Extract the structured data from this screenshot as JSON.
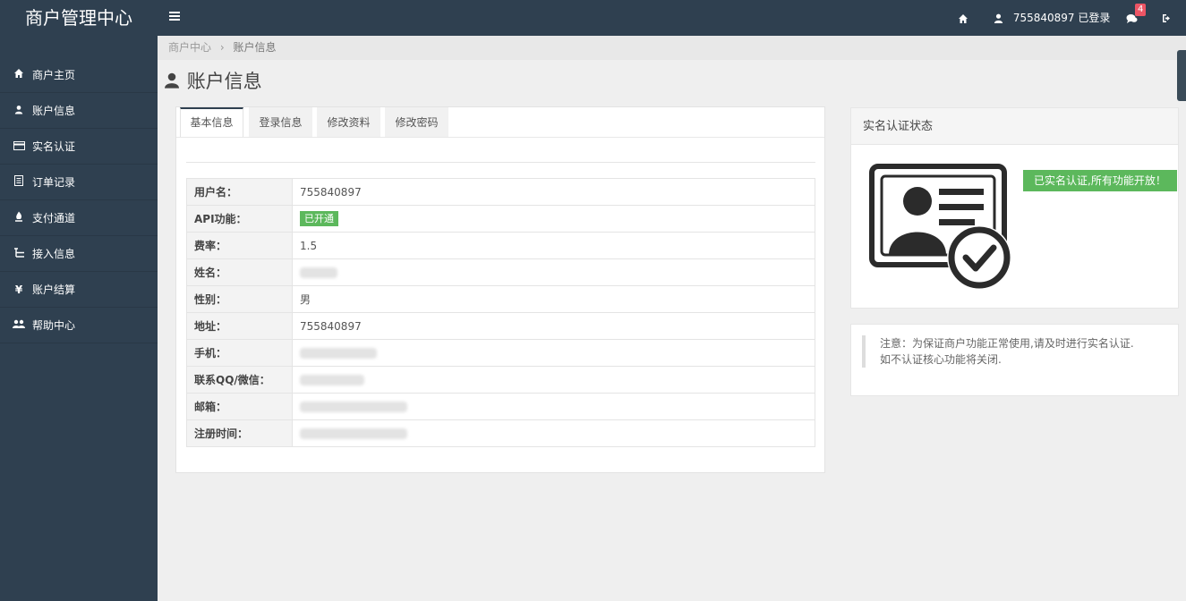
{
  "app": {
    "title": "商户管理中心"
  },
  "topbar": {
    "user_label": "755840897 已登录",
    "message_count": "4"
  },
  "sidebar": {
    "items": [
      {
        "label": "商户主页",
        "icon": "home-icon"
      },
      {
        "label": "账户信息",
        "icon": "user-icon"
      },
      {
        "label": "实名认证",
        "icon": "credit-card-icon"
      },
      {
        "label": "订单记录",
        "icon": "receipt-icon"
      },
      {
        "label": "支付通道",
        "icon": "fire-icon"
      },
      {
        "label": "接入信息",
        "icon": "sitemap-icon"
      },
      {
        "label": "账户结算",
        "icon": "yen-icon"
      },
      {
        "label": "帮助中心",
        "icon": "users-icon"
      }
    ]
  },
  "breadcrumb": {
    "root": "商户中心",
    "sep": "›",
    "current": "账户信息"
  },
  "page": {
    "title": "账户信息"
  },
  "tabs": [
    "基本信息",
    "登录信息",
    "修改资料",
    "修改密码"
  ],
  "info": {
    "rows": [
      {
        "key": "用户名：",
        "value": "755840897"
      },
      {
        "key": "API功能：",
        "value": "已开通"
      },
      {
        "key": "费率：",
        "value": "1.5"
      },
      {
        "key": "姓名：",
        "value": ""
      },
      {
        "key": "性别：",
        "value": "男"
      },
      {
        "key": "地址：",
        "value": "755840897"
      },
      {
        "key": "手机：",
        "value": ""
      },
      {
        "key": "联系QQ/微信：",
        "value": ""
      },
      {
        "key": "邮箱：",
        "value": ""
      },
      {
        "key": "注册时间：",
        "value": ""
      }
    ]
  },
  "verify": {
    "title": "实名认证状态",
    "status": "已实名认证,所有功能开放！"
  },
  "notice": {
    "line1": "注意：为保证商户功能正常使用,请及时进行实名认证.",
    "line2": "如不认证核心功能将关闭."
  },
  "colors": {
    "sidebar": "#2f4050",
    "success": "#5cb85c",
    "badge": "#ed5565"
  }
}
